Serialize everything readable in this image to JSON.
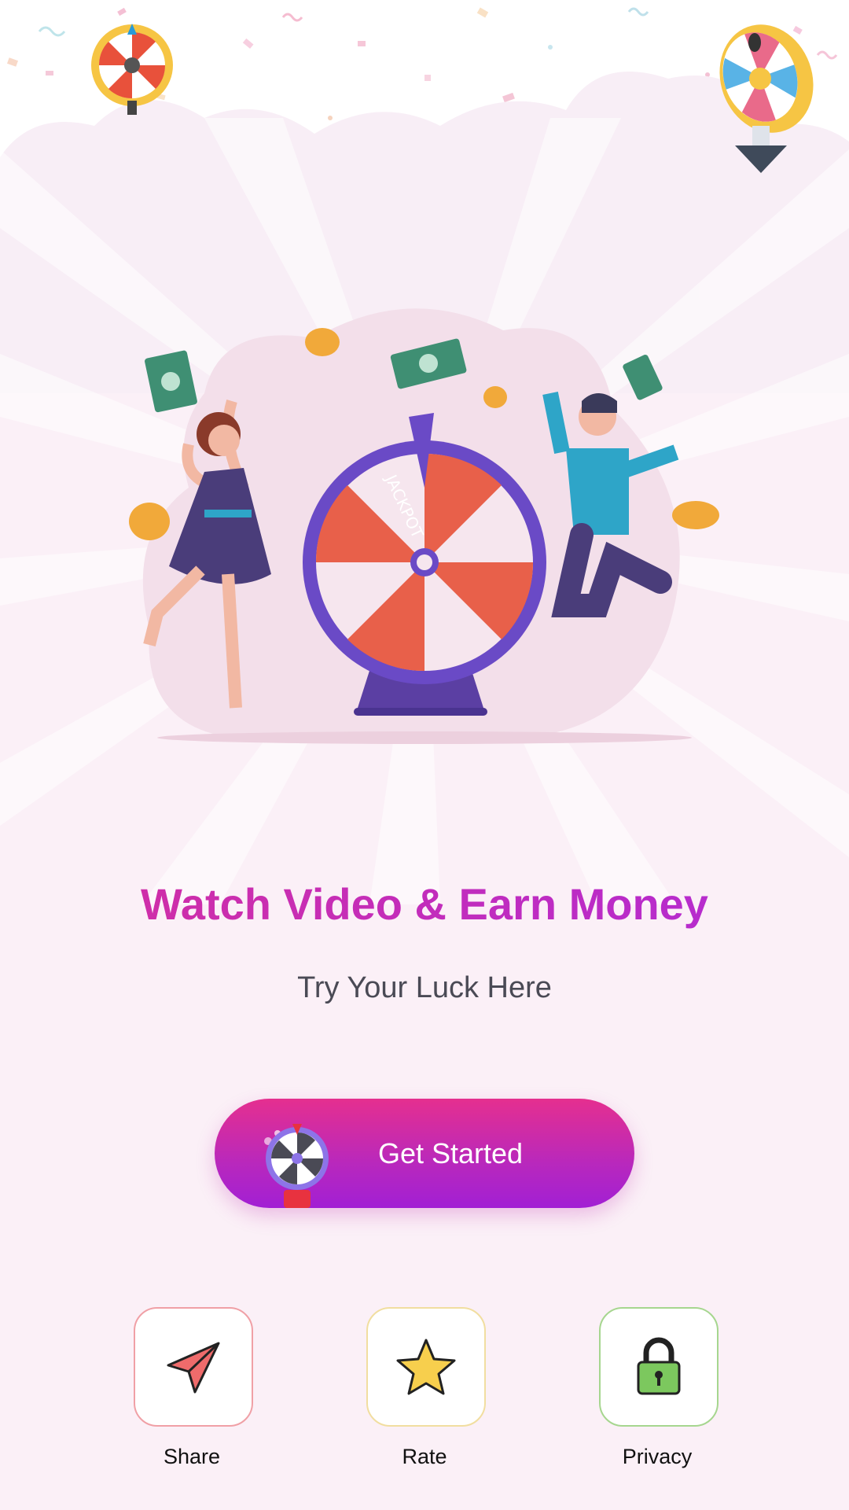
{
  "hero": {
    "title": "Watch Video & Earn Money",
    "subtitle": "Try Your Luck Here",
    "wheel_label": "JACKPOT"
  },
  "cta": {
    "label": "Get Started",
    "icon": "spin-wheel-icon"
  },
  "actions": [
    {
      "label": "Share",
      "icon": "send-icon",
      "border_color": "#f0a0a6"
    },
    {
      "label": "Rate",
      "icon": "star-icon",
      "border_color": "#f1dea0"
    },
    {
      "label": "Privacy",
      "icon": "lock-icon",
      "border_color": "#a6d68f"
    }
  ],
  "colors": {
    "title_gradient": [
      "#d42fa0",
      "#b12bd6"
    ],
    "button_gradient": [
      "#e52f8f",
      "#a21fd4"
    ],
    "background": "#fbf0f7"
  }
}
